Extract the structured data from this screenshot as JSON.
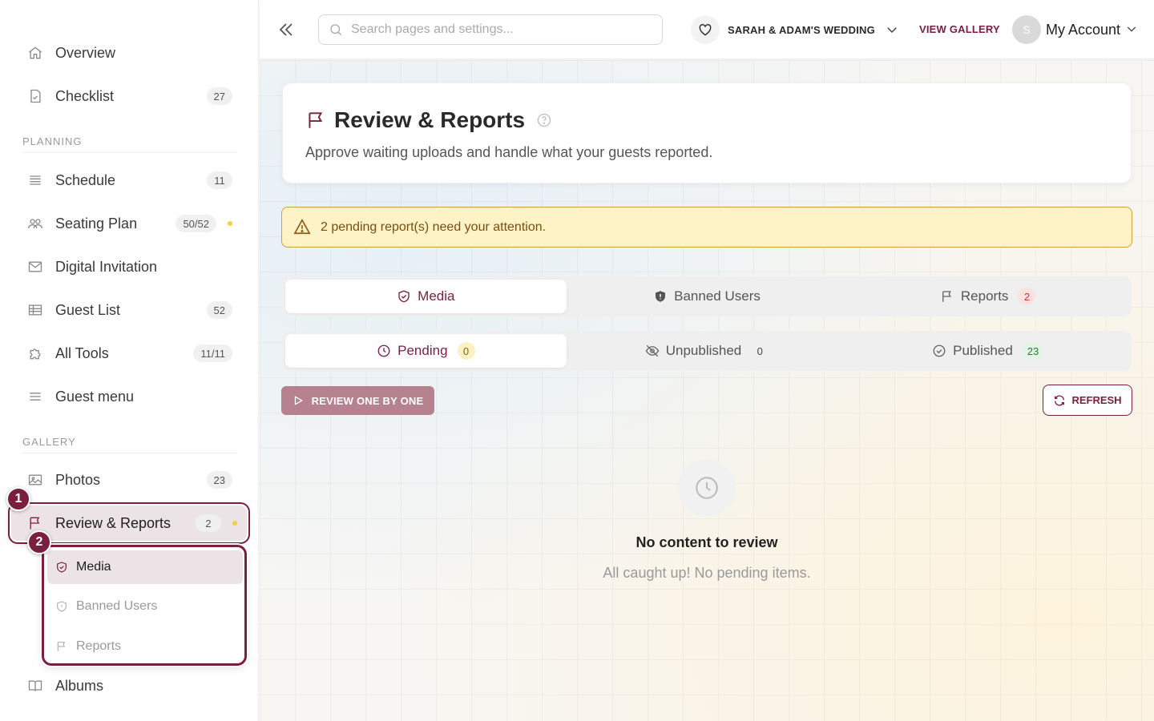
{
  "sidebar": {
    "items": [
      {
        "label": "Overview",
        "badge": ""
      },
      {
        "label": "Checklist",
        "badge": "27"
      },
      {
        "label": "Schedule",
        "badge": "11"
      },
      {
        "label": "Seating Plan",
        "badge": "50/52"
      },
      {
        "label": "Digital Invitation",
        "badge": ""
      },
      {
        "label": "Guest List",
        "badge": "52"
      },
      {
        "label": "All Tools",
        "badge": "11/11"
      },
      {
        "label": "Guest menu",
        "badge": ""
      },
      {
        "label": "Photos",
        "badge": "23"
      },
      {
        "label": "Review & Reports",
        "badge": "2"
      },
      {
        "label": "Albums",
        "badge": ""
      }
    ],
    "sections": {
      "planning": "PLANNING",
      "gallery": "GALLERY"
    },
    "sub_items": [
      {
        "label": "Media"
      },
      {
        "label": "Banned Users"
      },
      {
        "label": "Reports"
      }
    ],
    "step_badges": [
      "1",
      "2"
    ]
  },
  "topbar": {
    "search_placeholder": "Search pages and settings...",
    "event_name": "SARAH & ADAM'S WEDDING",
    "view_gallery": "VIEW GALLERY",
    "avatar_initial": "S",
    "account_label": "My Account"
  },
  "header": {
    "title": "Review & Reports",
    "subtitle": "Approve waiting uploads and handle what your guests reported."
  },
  "alert": {
    "text": "2 pending report(s) need your attention."
  },
  "main_tabs": [
    {
      "label": "Media",
      "count": ""
    },
    {
      "label": "Banned Users",
      "count": ""
    },
    {
      "label": "Reports",
      "count": "2"
    }
  ],
  "status_tabs": [
    {
      "label": "Pending",
      "count": "0"
    },
    {
      "label": "Unpublished",
      "count": "0"
    },
    {
      "label": "Published",
      "count": "23"
    }
  ],
  "actions": {
    "review": "REVIEW ONE BY ONE",
    "refresh": "REFRESH"
  },
  "empty": {
    "title": "No content to review",
    "subtitle": "All caught up! No pending items."
  },
  "colors": {
    "accent": "#7a1f3d",
    "alert_bg": "#fdf3c6",
    "alert_border": "#c9a23a"
  }
}
